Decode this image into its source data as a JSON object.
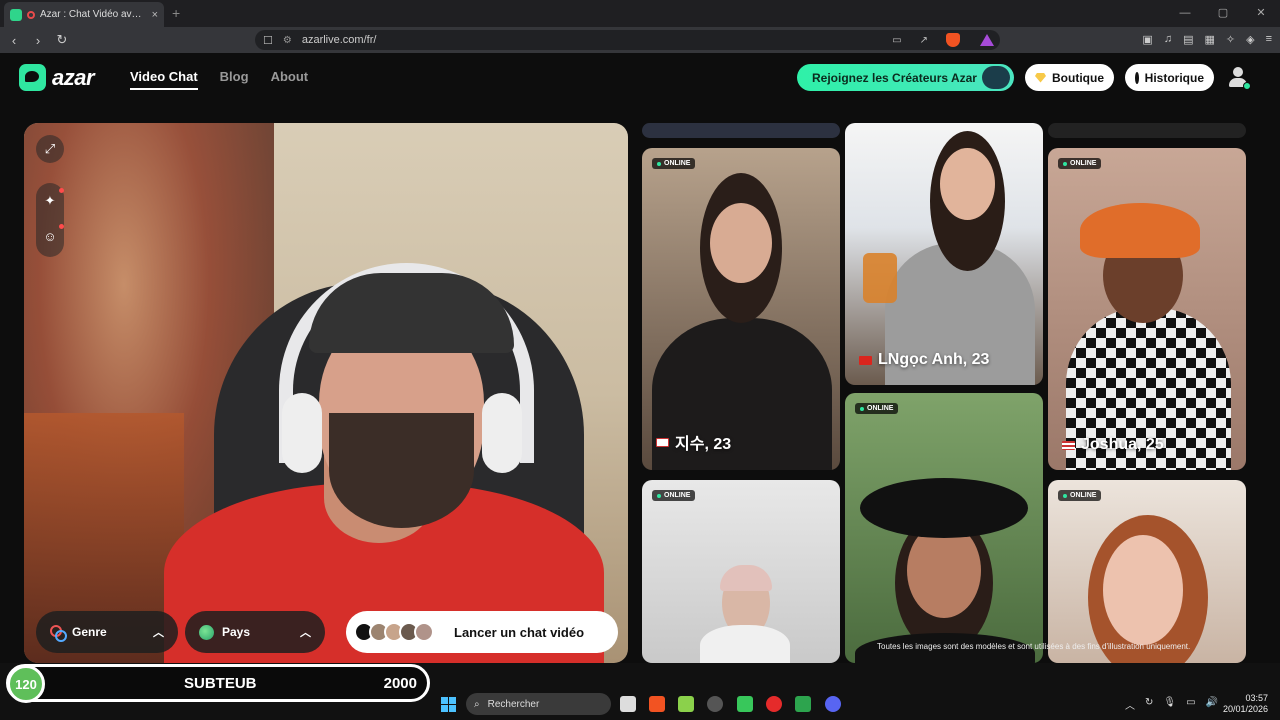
{
  "browser": {
    "tab_title": "Azar : Chat Vidéo avec de no",
    "tab_close": "×",
    "new_tab": "+",
    "url": "azarlive.com/fr/",
    "window_controls": [
      "—",
      "▢",
      "✕"
    ]
  },
  "site": {
    "logo_text": "azar",
    "nav": [
      {
        "label": "Video Chat",
        "active": true
      },
      {
        "label": "Blog",
        "active": false
      },
      {
        "label": "About",
        "active": false
      }
    ],
    "creators_button": "Rejoignez les Créateurs Azar",
    "shop_button": "Boutique",
    "history_button": "Historique"
  },
  "video": {
    "filter_genre": "Genre",
    "filter_pays": "Pays",
    "launch_button": "Lancer un chat vidéo"
  },
  "cards": {
    "online_label": "ONLINE",
    "jisu": "지수, 23",
    "ngoc": "LNgọc Anh, 23",
    "joshua": "Joshua, 25",
    "disclaimer": "Toutes les images sont des modèles et sont utilisées à des fins d'illustration uniquement."
  },
  "overlay_bar": {
    "level": "120",
    "name": "SUBTEUB",
    "target": "2000"
  },
  "taskbar": {
    "search_placeholder": "Rechercher",
    "time": "03:57",
    "date": "20/01/2026"
  },
  "colors": {
    "accent": "#2fe6a0",
    "background": "#0d0d0d"
  }
}
